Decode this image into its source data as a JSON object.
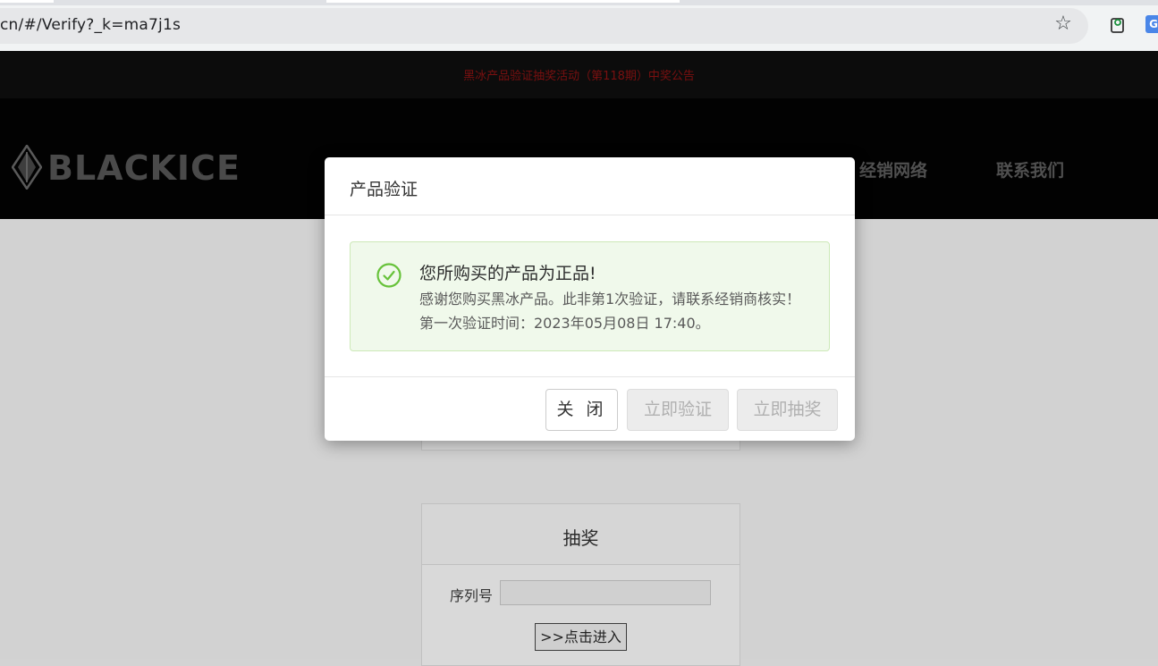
{
  "browser": {
    "url": "cn/#/Verify?_k=ma7j1s",
    "bookmark_icon": "star-icon",
    "extensions": [
      "extension-icon",
      "google-translate-icon"
    ]
  },
  "site": {
    "notice": "黑冰产品验证抽奖活动（第118期）中奖公告",
    "logo_text": "BLACKICE",
    "logo_reg": "®",
    "nav": [
      {
        "label": "经销网络"
      },
      {
        "label": "联系我们"
      }
    ]
  },
  "lottery": {
    "title": "抽奖",
    "serial_label": "序列号",
    "serial_value": "",
    "enter_button": ">>点击进入"
  },
  "dialog": {
    "title": "产品验证",
    "alert": {
      "icon": "check-circle-icon",
      "title": "您所购买的产品为正品!",
      "body": "感谢您购买黑冰产品。此非第1次验证，请联系经销商核实！第一次验证时间：2023年05月08日 17:40。"
    },
    "buttons": {
      "close": "关 闭",
      "verify": "立即验证",
      "draw": "立即抽奖"
    }
  },
  "colors": {
    "success_green": "#67c23a",
    "alert_bg": "#f0f9eb",
    "notice_text": "#7a1010"
  }
}
